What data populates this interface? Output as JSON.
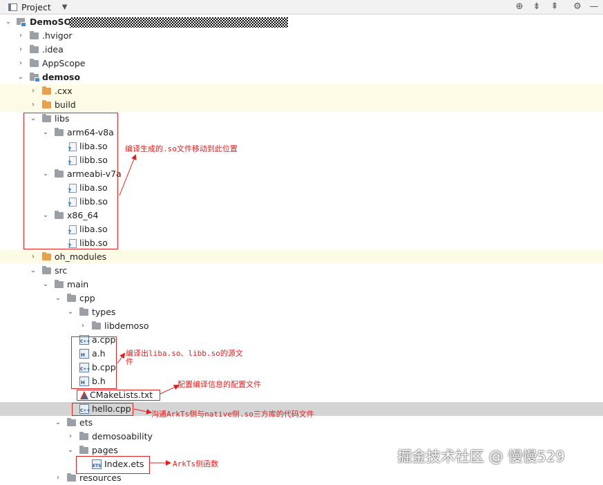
{
  "panel": {
    "title": "Project"
  },
  "toolbar_icons": [
    "locate-icon",
    "expand-all-icon",
    "collapse-all-icon",
    "settings-icon",
    "hide-icon"
  ],
  "tree": {
    "root": "DemoSO",
    "hvigor": ".hvigor",
    "idea": ".idea",
    "appscope": "AppScope",
    "demoso": "demoso",
    "cxx": ".cxx",
    "build": "build",
    "libs": "libs",
    "arm64": "arm64-v8a",
    "armeabi": "armeabi-v7a",
    "x86": "x86_64",
    "liba": "liba.so",
    "libb": "libb.so",
    "oh_modules": "oh_modules",
    "src": "src",
    "main": "main",
    "cpp": "cpp",
    "types": "types",
    "libdemoso": "libdemoso",
    "a_cpp": "a.cpp",
    "a_h": "a.h",
    "b_cpp": "b.cpp",
    "b_h": "b.h",
    "cmake": "CMakeLists.txt",
    "hello": "hello.cpp",
    "ets": "ets",
    "demosoability": "demosoability",
    "pages": "pages",
    "index": "Index.ets",
    "resources": "resources"
  },
  "annotations": {
    "libs_note": "编译生成的.so文件移动到此位置",
    "src_note_line1": "编译出liba.so、libb.so的源文",
    "src_note_line2": "件",
    "cmake_note": "配置编译信息的配置文件",
    "hello_note": "沟通ArkTs侧与native侧.so三方库的代码文件",
    "index_note": "ArkTs侧函数"
  },
  "watermark": "掘金技术社区 @ 慢慢529",
  "colors": {
    "annotation": "#e02020",
    "selected_row": "#d4d4d4",
    "highlight_row": "#fdfbe6"
  }
}
